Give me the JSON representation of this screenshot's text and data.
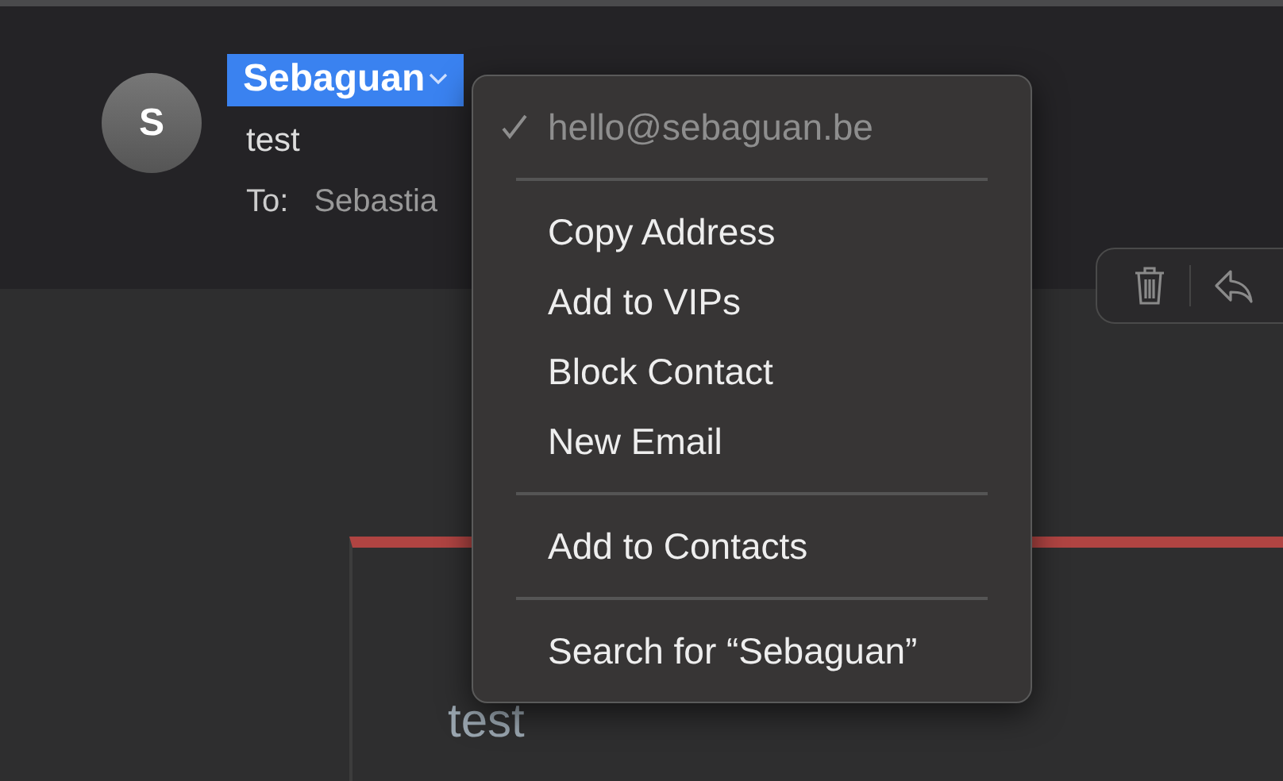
{
  "message": {
    "avatar": "S",
    "sender": "Sebaguan",
    "sender_selected": true,
    "subject": "test",
    "to_label": "To:",
    "to": "Sebastia"
  },
  "toolbar": {
    "buttons": [
      {
        "kind": "trash"
      },
      {
        "kind": "reply"
      }
    ]
  },
  "body": {
    "text": "test"
  },
  "context_menu": {
    "items": [
      {
        "kind": "item",
        "label": "hello@sebaguan.be",
        "checked": true,
        "disabled": true
      },
      {
        "kind": "separator"
      },
      {
        "kind": "item",
        "label": "Copy Address",
        "checked": false,
        "disabled": false
      },
      {
        "kind": "item",
        "label": "Add to VIPs",
        "checked": false,
        "disabled": false
      },
      {
        "kind": "item",
        "label": "Block Contact",
        "checked": false,
        "disabled": false
      },
      {
        "kind": "item",
        "label": "New Email",
        "checked": false,
        "disabled": false
      },
      {
        "kind": "separator"
      },
      {
        "kind": "item",
        "label": "Add to Contacts",
        "checked": false,
        "disabled": false
      },
      {
        "kind": "separator"
      },
      {
        "kind": "item",
        "label": "Search for “Sebaguan”",
        "checked": false,
        "disabled": false
      }
    ]
  }
}
